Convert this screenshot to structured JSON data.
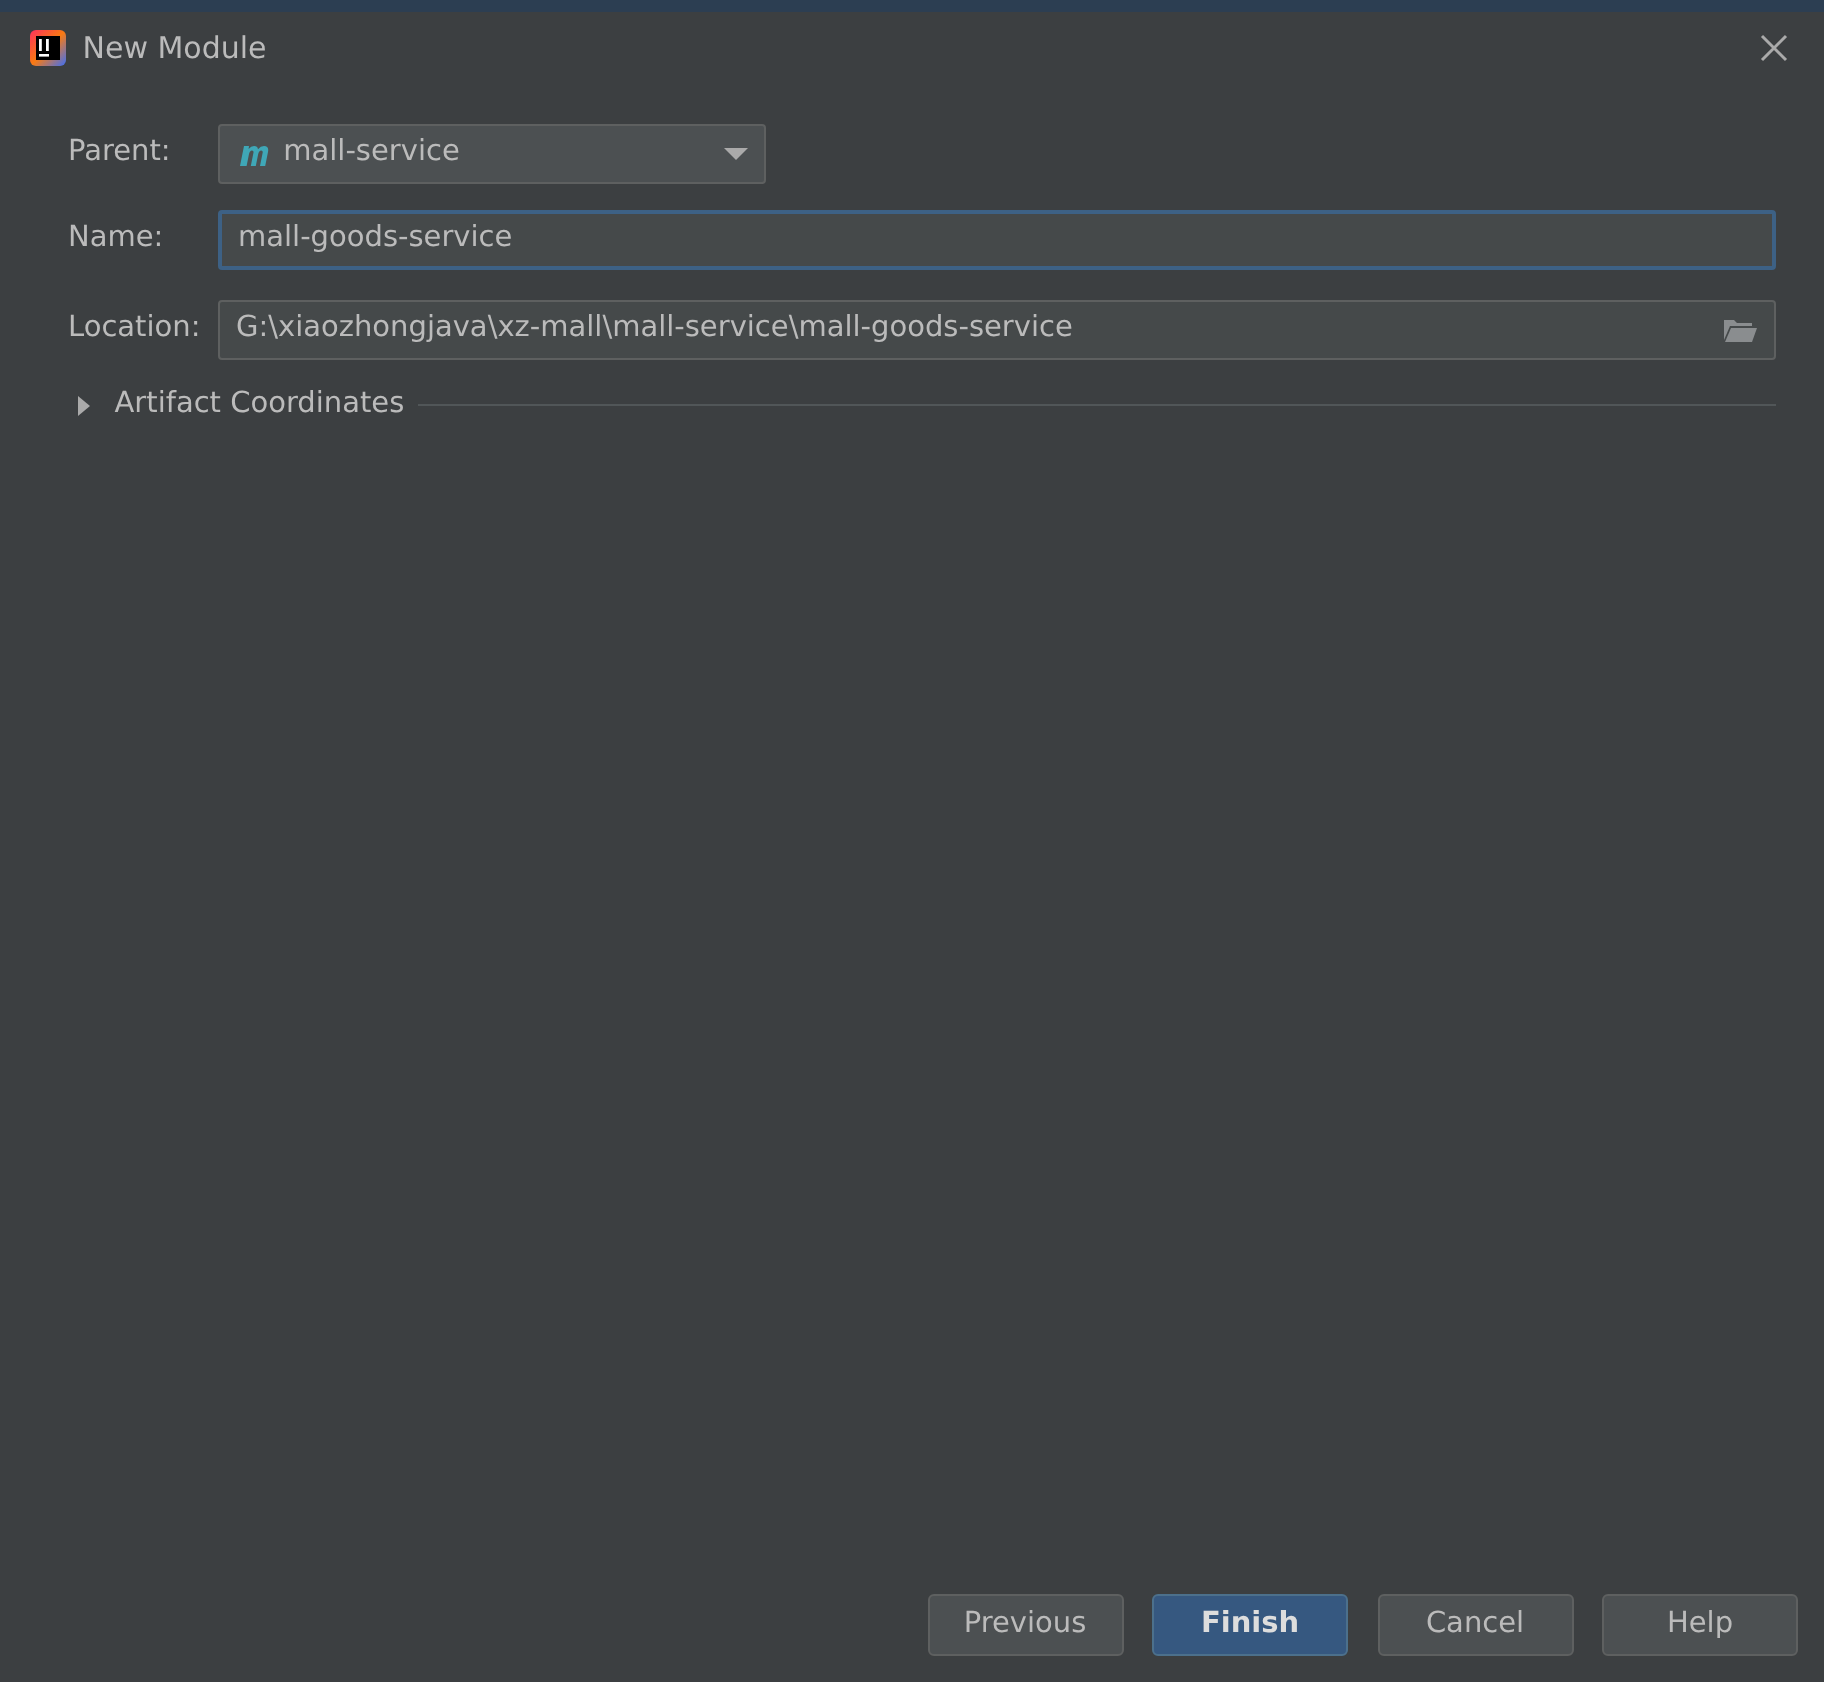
{
  "window": {
    "title": "New Module"
  },
  "fields": [
    {
      "kind": "dropdown",
      "label": "Parent:",
      "value": "mall-service",
      "focused": false
    },
    {
      "kind": "text",
      "label": "Name:",
      "value": "mall-goods-service",
      "focused": true
    },
    {
      "kind": "path",
      "label": "Location:",
      "value": "G:\\xiaozhongjava\\xz-mall\\mall-service\\mall-goods-service",
      "focused": false
    }
  ],
  "section": {
    "label": "Artifact Coordinates",
    "expanded": false
  },
  "buttons": [
    {
      "label": "Previous",
      "primary": false
    },
    {
      "label": "Finish",
      "primary": true
    },
    {
      "label": "Cancel",
      "primary": false
    },
    {
      "label": "Help",
      "primary": false
    }
  ]
}
